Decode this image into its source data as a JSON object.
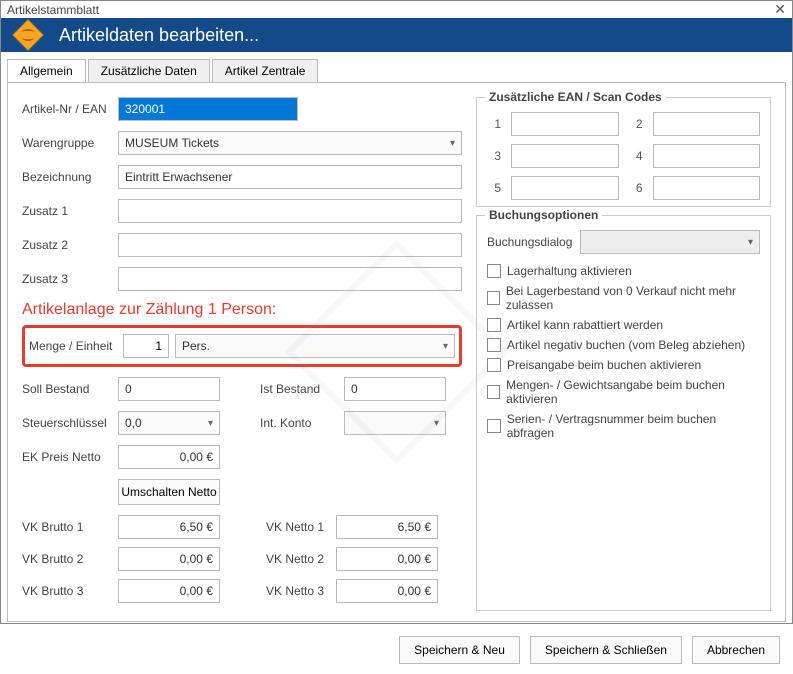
{
  "window": {
    "title": "Artikelstammblatt"
  },
  "banner": {
    "title": "Artikeldaten bearbeiten..."
  },
  "tabs": [
    {
      "label": "Allgemein"
    },
    {
      "label": "Zusätzliche Daten"
    },
    {
      "label": "Artikel Zentrale"
    }
  ],
  "form": {
    "artikel_nr_label": "Artikel-Nr / EAN",
    "artikel_nr_value": "320001",
    "warengruppe_label": "Warengruppe",
    "warengruppe_value": "MUSEUM Tickets",
    "bezeichnung_label": "Bezeichnung",
    "bezeichnung_value": "Eintritt Erwachsener",
    "zusatz1_label": "Zusatz 1",
    "zusatz1_value": "",
    "zusatz2_label": "Zusatz 2",
    "zusatz2_value": "",
    "zusatz3_label": "Zusatz 3",
    "zusatz3_value": "",
    "annotation": "Artikelanlage zur Zählung 1 Person:",
    "menge_label": "Menge / Einheit",
    "menge_value": "1",
    "einheit_value": "Pers.",
    "soll_label": "Soll Bestand",
    "soll_value": "0",
    "ist_label": "Ist Bestand",
    "ist_value": "0",
    "steuer_label": "Steuerschlüssel",
    "steuer_value": "0,0",
    "konto_label": "Int. Konto",
    "konto_value": "",
    "ek_label": "EK Preis Netto",
    "ek_value": "0,00 €",
    "toggle_label": "Umschalten Netto",
    "vk": [
      {
        "brutto_label": "VK Brutto 1",
        "brutto_value": "6,50 €",
        "netto_label": "VK Netto 1",
        "netto_value": "6,50 €"
      },
      {
        "brutto_label": "VK Brutto 2",
        "brutto_value": "0,00 €",
        "netto_label": "VK Netto 2",
        "netto_value": "0,00 €"
      },
      {
        "brutto_label": "VK Brutto 3",
        "brutto_value": "0,00 €",
        "netto_label": "VK Netto 3",
        "netto_value": "0,00 €"
      }
    ]
  },
  "eanGroup": {
    "title": "Zusätzliche EAN / Scan Codes",
    "slots": [
      {
        "n": "1",
        "v": ""
      },
      {
        "n": "2",
        "v": ""
      },
      {
        "n": "3",
        "v": ""
      },
      {
        "n": "4",
        "v": ""
      },
      {
        "n": "5",
        "v": ""
      },
      {
        "n": "6",
        "v": ""
      }
    ]
  },
  "bookGroup": {
    "title": "Buchungsoptionen",
    "dialog_label": "Buchungsdialog",
    "dialog_value": "",
    "checks": [
      "Lagerhaltung aktivieren",
      "Bei Lagerbestand von 0 Verkauf nicht mehr zulassen",
      "Artikel kann rabattiert werden",
      "Artikel negativ buchen (vom Beleg abziehen)",
      "Preisangabe beim buchen aktivieren",
      "Mengen- / Gewichtsangabe beim buchen aktivieren",
      "Serien- / Vertragsnummer beim buchen abfragen"
    ]
  },
  "buttons": {
    "save_new": "Speichern & Neu",
    "save_close": "Speichern & Schließen",
    "cancel": "Abbrechen"
  }
}
